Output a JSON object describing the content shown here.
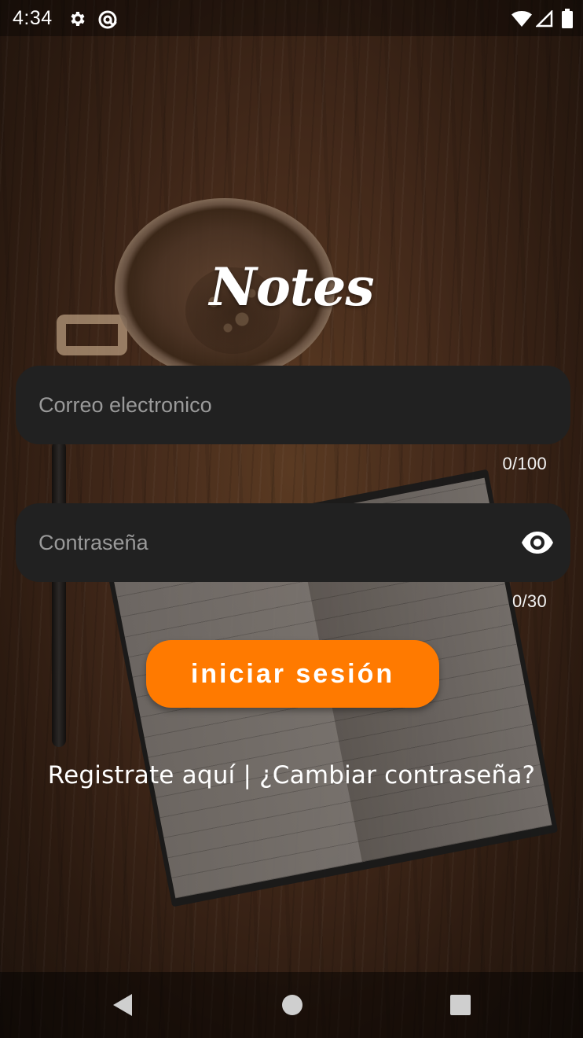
{
  "status_bar": {
    "time": "4:34",
    "icons": [
      "settings-gear-icon",
      "at-sign-notification-icon",
      "wifi-icon",
      "cell-signal-icon",
      "battery-icon"
    ]
  },
  "app": {
    "logo_text": "Notes"
  },
  "login_form": {
    "email": {
      "placeholder": "Correo electronico",
      "value": "",
      "counter": "0/100"
    },
    "password": {
      "placeholder": "Contraseña",
      "value": "",
      "counter": "0/30",
      "toggle_icon": "eye-icon"
    },
    "submit_label": "iniciar sesión"
  },
  "links": {
    "register": "Registrate aquí",
    "separator": "|",
    "change_password": "¿Cambiar contraseña?"
  },
  "nav_bar": {
    "buttons": [
      "back-icon",
      "home-icon",
      "recents-icon"
    ]
  },
  "colors": {
    "accent": "#ff7a00",
    "field_background": "#212121",
    "text": "#ffffff"
  }
}
